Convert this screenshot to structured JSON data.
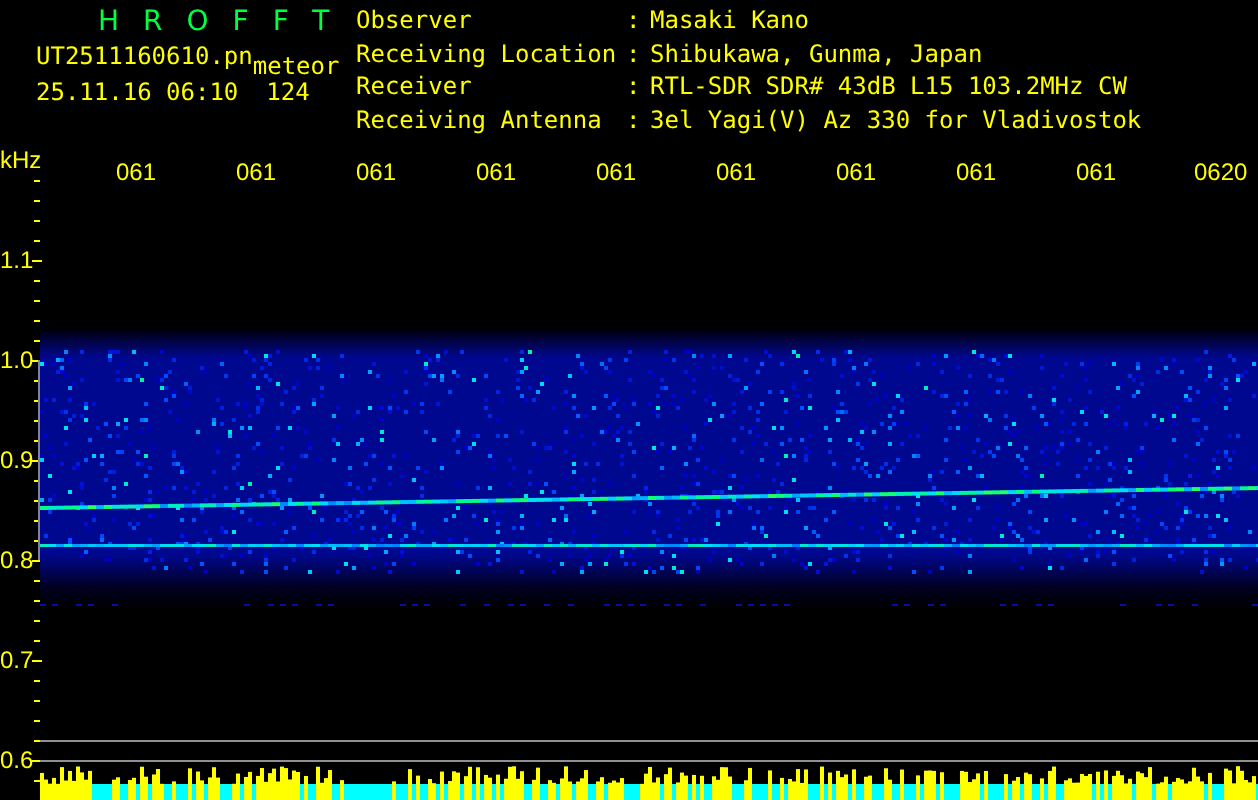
{
  "app_title": "HROFFT",
  "file": {
    "name": "UT2511160610.pn",
    "label": "meteor",
    "timestamp": "25.11.16 06:10",
    "count": "124"
  },
  "station": [
    {
      "label": "Observer",
      "separator": ":",
      "value": "Masaki Kano"
    },
    {
      "label": "Receiving Location",
      "separator": ":",
      "value": "Shibukawa, Gunma, Japan"
    },
    {
      "label": "Receiver",
      "separator": ":",
      "value": "RTL-SDR SDR# 43dB L15 103.2MHz CW"
    },
    {
      "label": "Receiving Antenna",
      "separator": ":",
      "value": "3el Yagi(V) Az 330 for Vladivostok"
    }
  ],
  "plot": {
    "unit": "kHz",
    "time_labels": [
      "061",
      "061",
      "061",
      "061",
      "061",
      "061",
      "061",
      "061",
      "061",
      "0620"
    ],
    "frequency_labels": [
      "1.1",
      "1.0",
      "0.9",
      "0.8",
      "0.7",
      "0.6"
    ]
  }
}
